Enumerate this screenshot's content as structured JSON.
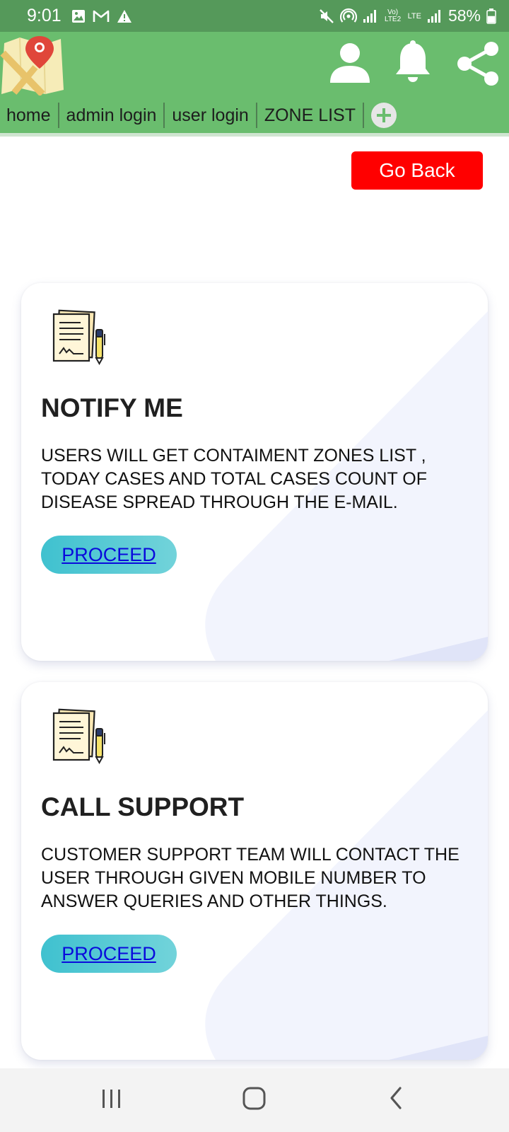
{
  "status_bar": {
    "time": "9:01",
    "left_icons": [
      "gallery-icon",
      "gmail-icon",
      "warning-icon"
    ],
    "right_icons": [
      "mute-icon",
      "hotspot-icon",
      "signal-icon",
      "volte-lte2-icon",
      "lte-icon",
      "signal-icon"
    ],
    "volte_text": "Vo) LTE2",
    "lte_text": "LTE",
    "battery_percent": "58%",
    "battery_level": 0.58
  },
  "app_bar": {
    "background_color": "#6abd6e",
    "nav": [
      {
        "label": "home"
      },
      {
        "label": "admin login"
      },
      {
        "label": "user login"
      },
      {
        "label": "ZONE LIST"
      }
    ]
  },
  "go_back": {
    "label": "Go Back",
    "color": "#ff0000"
  },
  "cards": [
    {
      "title": "NOTIFY ME",
      "description": "USERS WILL GET CONTAIMENT ZONES LIST , TODAY CASES AND TOTAL CASES COUNT OF DISEASE SPREAD THROUGH THE E-MAIL.",
      "button_label": "PROCEED"
    },
    {
      "title": "CALL SUPPORT",
      "description": "CUSTOMER SUPPORT TEAM WILL CONTACT THE USER THROUGH GIVEN MOBILE NUMBER TO ANSWER QUERIES AND OTHER THINGS.",
      "button_label": "PROCEED"
    }
  ]
}
